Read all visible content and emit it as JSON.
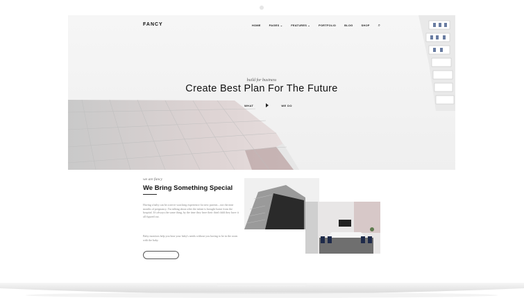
{
  "header": {
    "logo": "FANCY",
    "nav": [
      {
        "label": "HOME"
      },
      {
        "label": "PAGES ⌄"
      },
      {
        "label": "FEATURES ⌄"
      },
      {
        "label": "PORTFOLIO"
      },
      {
        "label": "BLOG"
      },
      {
        "label": "SHOP"
      }
    ],
    "search_icon": "search-icon"
  },
  "hero": {
    "kicker": "build for business",
    "headline": "Create Best Plan For The Future",
    "left_label": "WHAT",
    "right_label": "WE DO",
    "play_icon": "play-icon"
  },
  "about": {
    "kicker": "we are fancy",
    "title": "We Bring Something Special",
    "paragraph1": "Having a baby can be a nerve wracking experience for new parents – not the nine months of pregnancy, I'm talking about after the infant is brought home from the hospital. It's always the same thing, by the time they have their third child they have it all figured out.",
    "paragraph2": "Baby monitors help you hear your baby's needs without you having to be in the room with the baby.",
    "button_label": ""
  },
  "colors": {
    "text_dark": "#111111",
    "text_muted": "#888888",
    "hero_bg": "#f4f4f4"
  }
}
